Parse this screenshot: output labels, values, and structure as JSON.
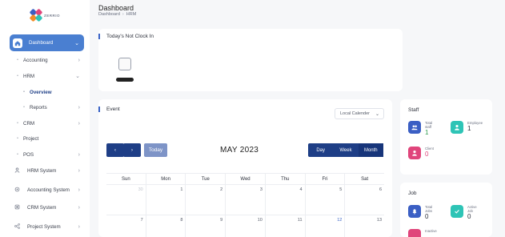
{
  "brand": {
    "logo_text": "ZERRIO",
    "colors": {
      "blue": "#3b5fc4",
      "pink": "#e0457b",
      "teal": "#2ec4b6",
      "orange": "#f28c28"
    }
  },
  "header": {
    "title": "Dashboard",
    "breadcrumb": [
      "Dashboard",
      "HRM"
    ]
  },
  "sidebar": {
    "items": [
      {
        "label": "Dashboard",
        "icon": "home-icon",
        "active": true
      },
      {
        "label": "Accounting",
        "icon": "bullet"
      },
      {
        "label": "HRM",
        "icon": "bullet"
      },
      {
        "label": "Overview",
        "icon": "bullet"
      },
      {
        "label": "Reports",
        "icon": "bullet"
      },
      {
        "label": "CRM",
        "icon": "bullet"
      },
      {
        "label": "Project",
        "icon": "bullet"
      },
      {
        "label": "POS",
        "icon": "bullet"
      },
      {
        "label": "HRM System",
        "icon": "user-icon"
      },
      {
        "label": "Accounting System",
        "icon": "gear-icon"
      },
      {
        "label": "CRM System",
        "icon": "layers-icon"
      },
      {
        "label": "Project System",
        "icon": "share-icon"
      }
    ]
  },
  "not_clock_in": {
    "title": "Today's Not Clock In"
  },
  "event": {
    "title": "Event",
    "calendar_select": "Local Calender",
    "today_label": "Today",
    "month_title": "MAY 2023",
    "views": [
      "Day",
      "Week",
      "Month"
    ],
    "weekdays": [
      "Sun",
      "Mon",
      "Tue",
      "Wed",
      "Thu",
      "Fri",
      "Sat"
    ],
    "weeks": [
      [
        "30",
        "1",
        "2",
        "3",
        "4",
        "5",
        "6"
      ],
      [
        "7",
        "8",
        "9",
        "10",
        "11",
        "12",
        "13"
      ]
    ]
  },
  "staff": {
    "title": "Staff",
    "stats": [
      {
        "label_1": "Total",
        "label_2": "staff",
        "value": "1",
        "color": "#3b5fc4",
        "value_color": "#2e9b4f",
        "icon": "users-icon"
      },
      {
        "label_1": "Employee",
        "label_2": "",
        "value": "1",
        "color": "#2ec4b6",
        "value_color": "#2b2f3a",
        "icon": "user-icon"
      },
      {
        "label_1": "Client",
        "label_2": "",
        "value": "0",
        "color": "#e0457b",
        "value_color": "#e0457b",
        "icon": "user-icon"
      }
    ]
  },
  "job": {
    "title": "Job",
    "stats": [
      {
        "label_1": "Total",
        "label_2": "Jobs",
        "value": "0",
        "color": "#3b5fc4",
        "value_color": "#2b2f3a",
        "icon": "bell-icon"
      },
      {
        "label_1": "Active",
        "label_2": "Job",
        "value": "0",
        "color": "#2ec4b6",
        "value_color": "#2b2f3a",
        "icon": "check-icon"
      },
      {
        "label_1": "Inactive",
        "label_2": "",
        "value": "",
        "color": "#e0457b",
        "value_color": "#2b2f3a",
        "icon": "x-icon"
      }
    ]
  }
}
